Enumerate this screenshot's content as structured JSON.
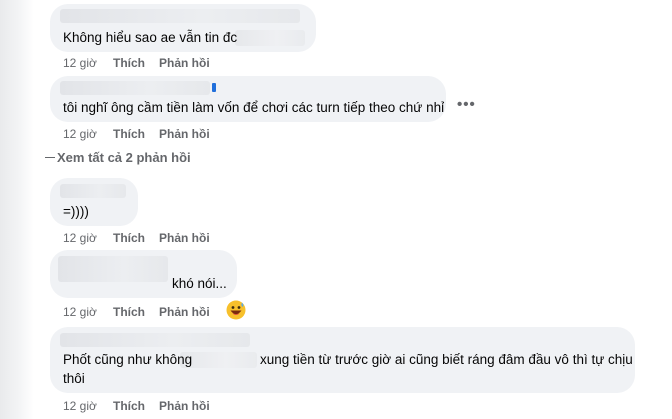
{
  "comments": [
    {
      "text": "Không hiểu sao ae vẫn tin đc",
      "time": "12 giờ",
      "like": "Thích",
      "reply": "Phản hồi"
    },
    {
      "text": "tôi nghĩ ông cầm tiền làm vốn để chơi các turn tiếp theo chứ nhỉ",
      "time": "12 giờ",
      "like": "Thích",
      "reply": "Phản hồi"
    },
    {
      "text": "=))))",
      "time": "12 giờ",
      "like": "Thích",
      "reply": "Phản hồi"
    },
    {
      "text": "khó nói...",
      "time": "12 giờ",
      "like": "Thích",
      "reply": "Phản hồi"
    },
    {
      "text_part1": "Phốt cũng như không",
      "text_part2": "xung tiền từ trước giờ ai cũng biết ráng đâm đầu vô thì tự chịu",
      "text_line2": "thôi",
      "time": "12 giờ",
      "like": "Thích",
      "reply": "Phản hồi"
    }
  ],
  "view_more_replies": "Xem tất cả 2 phản hồi",
  "more_icon": "more-horizontal-icon",
  "emoji_icon": "grinning-face-sweat-icon",
  "colors": {
    "bubble": "#f0f2f5",
    "meta_text": "#65676b",
    "text": "#050505",
    "link_name": "#216fdb"
  }
}
